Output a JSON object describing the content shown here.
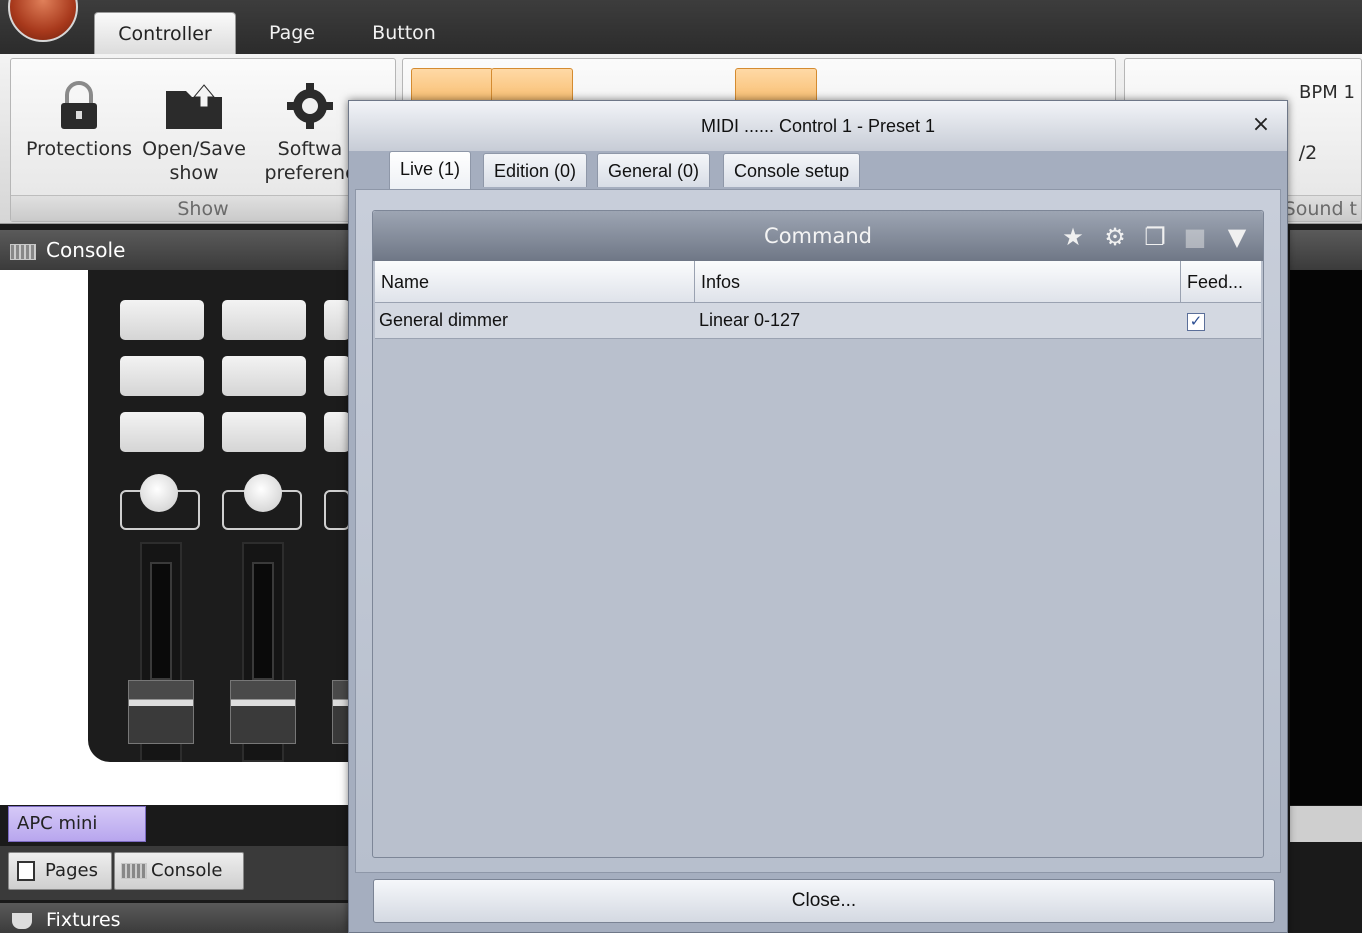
{
  "ribbon": {
    "tabs": [
      "Controller",
      "Page",
      "Button"
    ],
    "active_tab": "Controller",
    "protections_label": "Protections",
    "open_save_label_1": "Open/Save",
    "open_save_label_2": "show",
    "software_label_1": "Softwa",
    "software_label_2": "preferenc",
    "show_group_label": "Show",
    "bpm_label": "BPM 1",
    "half_label": "/2",
    "sound_label": "Sound t"
  },
  "console": {
    "title": "Console",
    "device_name": "APC mini",
    "bottom_tabs": [
      "Pages",
      "Console"
    ],
    "fixtures_label": "Fixtures"
  },
  "dialog": {
    "title": "MIDI ...... Control 1 - Preset 1",
    "close_glyph": "×",
    "tabs": [
      "Live (1)",
      "Edition (0)",
      "General (0)",
      "Console setup"
    ],
    "panel_title": "Command",
    "columns": [
      "Name",
      "Infos",
      "Feed..."
    ],
    "rows": [
      {
        "name": "General dimmer",
        "infos": "Linear 0-127",
        "feedback": true
      }
    ],
    "close_button": "Close..."
  },
  "icons": {
    "panel": [
      "star-icon",
      "gear-icon",
      "copy-icon",
      "paste-icon",
      "delete-icon"
    ]
  }
}
